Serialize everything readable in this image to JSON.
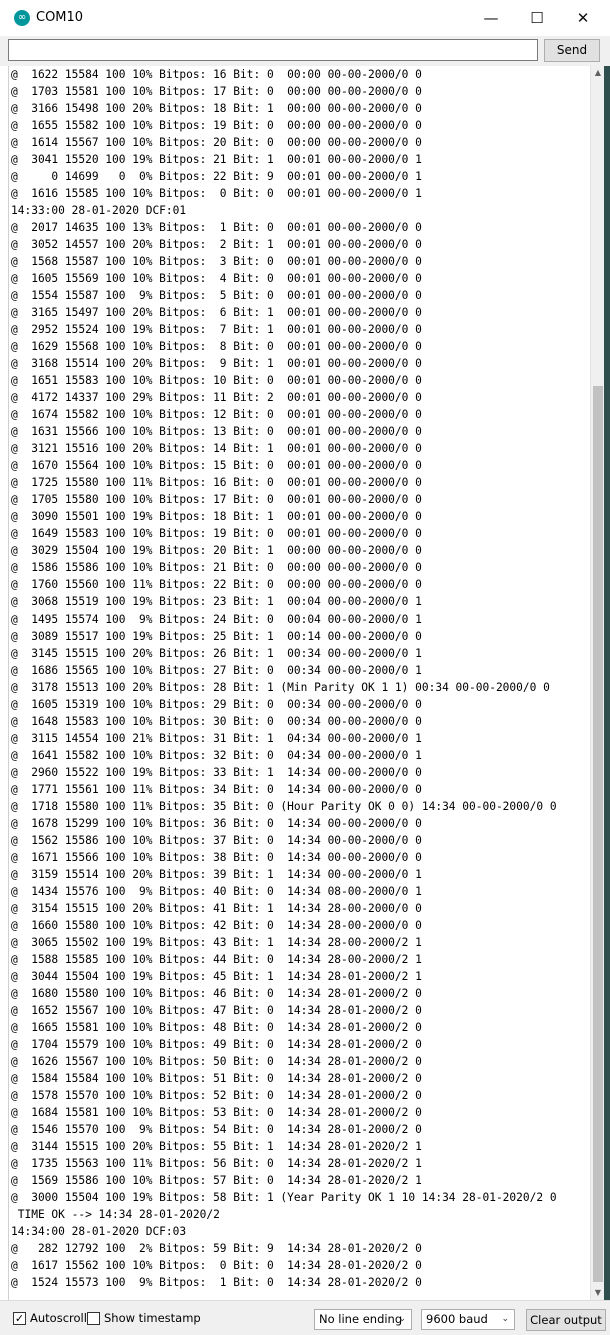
{
  "window": {
    "title": "COM10",
    "minimize_glyph": "—",
    "maximize_glyph": "☐",
    "close_glyph": "✕",
    "app_icon": "arduino-icon"
  },
  "input": {
    "value": "",
    "send_label": "Send"
  },
  "output_lines": [
    "@  1622 15584 100 10% Bitpos: 16 Bit: 0  00:00 00-00-2000/0 0",
    "@  1703 15581 100 10% Bitpos: 17 Bit: 0  00:00 00-00-2000/0 0",
    "@  3166 15498 100 20% Bitpos: 18 Bit: 1  00:00 00-00-2000/0 0",
    "@  1655 15582 100 10% Bitpos: 19 Bit: 0  00:00 00-00-2000/0 0",
    "@  1614 15567 100 10% Bitpos: 20 Bit: 0  00:00 00-00-2000/0 0",
    "@  3041 15520 100 19% Bitpos: 21 Bit: 1  00:01 00-00-2000/0 1",
    "@     0 14699   0  0% Bitpos: 22 Bit: 9  00:01 00-00-2000/0 1",
    "@  1616 15585 100 10% Bitpos:  0 Bit: 0  00:01 00-00-2000/0 1",
    "14:33:00 28-01-2020 DCF:01",
    "@  2017 14635 100 13% Bitpos:  1 Bit: 0  00:01 00-00-2000/0 0",
    "@  3052 14557 100 20% Bitpos:  2 Bit: 1  00:01 00-00-2000/0 0",
    "@  1568 15587 100 10% Bitpos:  3 Bit: 0  00:01 00-00-2000/0 0",
    "@  1605 15569 100 10% Bitpos:  4 Bit: 0  00:01 00-00-2000/0 0",
    "@  1554 15587 100  9% Bitpos:  5 Bit: 0  00:01 00-00-2000/0 0",
    "@  3165 15497 100 20% Bitpos:  6 Bit: 1  00:01 00-00-2000/0 0",
    "@  2952 15524 100 19% Bitpos:  7 Bit: 1  00:01 00-00-2000/0 0",
    "@  1629 15568 100 10% Bitpos:  8 Bit: 0  00:01 00-00-2000/0 0",
    "@  3168 15514 100 20% Bitpos:  9 Bit: 1  00:01 00-00-2000/0 0",
    "@  1651 15583 100 10% Bitpos: 10 Bit: 0  00:01 00-00-2000/0 0",
    "@  4172 14337 100 29% Bitpos: 11 Bit: 2  00:01 00-00-2000/0 0",
    "@  1674 15582 100 10% Bitpos: 12 Bit: 0  00:01 00-00-2000/0 0",
    "@  1631 15566 100 10% Bitpos: 13 Bit: 0  00:01 00-00-2000/0 0",
    "@  3121 15516 100 20% Bitpos: 14 Bit: 1  00:01 00-00-2000/0 0",
    "@  1670 15564 100 10% Bitpos: 15 Bit: 0  00:01 00-00-2000/0 0",
    "@  1725 15580 100 11% Bitpos: 16 Bit: 0  00:01 00-00-2000/0 0",
    "@  1705 15580 100 10% Bitpos: 17 Bit: 0  00:01 00-00-2000/0 0",
    "@  3090 15501 100 19% Bitpos: 18 Bit: 1  00:01 00-00-2000/0 0",
    "@  1649 15583 100 10% Bitpos: 19 Bit: 0  00:01 00-00-2000/0 0",
    "@  3029 15504 100 19% Bitpos: 20 Bit: 1  00:00 00-00-2000/0 0",
    "@  1586 15586 100 10% Bitpos: 21 Bit: 0  00:00 00-00-2000/0 0",
    "@  1760 15560 100 11% Bitpos: 22 Bit: 0  00:00 00-00-2000/0 0",
    "@  3068 15519 100 19% Bitpos: 23 Bit: 1  00:04 00-00-2000/0 1",
    "@  1495 15574 100  9% Bitpos: 24 Bit: 0  00:04 00-00-2000/0 1",
    "@  3089 15517 100 19% Bitpos: 25 Bit: 1  00:14 00-00-2000/0 0",
    "@  3145 15515 100 20% Bitpos: 26 Bit: 1  00:34 00-00-2000/0 1",
    "@  1686 15565 100 10% Bitpos: 27 Bit: 0  00:34 00-00-2000/0 1",
    "@  3178 15513 100 20% Bitpos: 28 Bit: 1 (Min Parity OK 1 1) 00:34 00-00-2000/0 0",
    "@  1605 15319 100 10% Bitpos: 29 Bit: 0  00:34 00-00-2000/0 0",
    "@  1648 15583 100 10% Bitpos: 30 Bit: 0  00:34 00-00-2000/0 0",
    "@  3115 14554 100 21% Bitpos: 31 Bit: 1  04:34 00-00-2000/0 1",
    "@  1641 15582 100 10% Bitpos: 32 Bit: 0  04:34 00-00-2000/0 1",
    "@  2960 15522 100 19% Bitpos: 33 Bit: 1  14:34 00-00-2000/0 0",
    "@  1771 15561 100 11% Bitpos: 34 Bit: 0  14:34 00-00-2000/0 0",
    "@  1718 15580 100 11% Bitpos: 35 Bit: 0 (Hour Parity OK 0 0) 14:34 00-00-2000/0 0",
    "@  1678 15299 100 10% Bitpos: 36 Bit: 0  14:34 00-00-2000/0 0",
    "@  1562 15586 100 10% Bitpos: 37 Bit: 0  14:34 00-00-2000/0 0",
    "@  1671 15566 100 10% Bitpos: 38 Bit: 0  14:34 00-00-2000/0 0",
    "@  3159 15514 100 20% Bitpos: 39 Bit: 1  14:34 00-00-2000/0 1",
    "@  1434 15576 100  9% Bitpos: 40 Bit: 0  14:34 08-00-2000/0 1",
    "@  3154 15515 100 20% Bitpos: 41 Bit: 1  14:34 28-00-2000/0 0",
    "@  1660 15580 100 10% Bitpos: 42 Bit: 0  14:34 28-00-2000/0 0",
    "@  3065 15502 100 19% Bitpos: 43 Bit: 1  14:34 28-00-2000/2 1",
    "@  1588 15585 100 10% Bitpos: 44 Bit: 0  14:34 28-00-2000/2 1",
    "@  3044 15504 100 19% Bitpos: 45 Bit: 1  14:34 28-01-2000/2 1",
    "@  1680 15580 100 10% Bitpos: 46 Bit: 0  14:34 28-01-2000/2 0",
    "@  1652 15567 100 10% Bitpos: 47 Bit: 0  14:34 28-01-2000/2 0",
    "@  1665 15581 100 10% Bitpos: 48 Bit: 0  14:34 28-01-2000/2 0",
    "@  1704 15579 100 10% Bitpos: 49 Bit: 0  14:34 28-01-2000/2 0",
    "@  1626 15567 100 10% Bitpos: 50 Bit: 0  14:34 28-01-2000/2 0",
    "@  1584 15584 100 10% Bitpos: 51 Bit: 0  14:34 28-01-2000/2 0",
    "@  1578 15570 100 10% Bitpos: 52 Bit: 0  14:34 28-01-2000/2 0",
    "@  1684 15581 100 10% Bitpos: 53 Bit: 0  14:34 28-01-2000/2 0",
    "@  1546 15570 100  9% Bitpos: 54 Bit: 0  14:34 28-01-2000/2 0",
    "@  3144 15515 100 20% Bitpos: 55 Bit: 1  14:34 28-01-2020/2 1",
    "@  1735 15563 100 11% Bitpos: 56 Bit: 0  14:34 28-01-2020/2 1",
    "@  1569 15586 100 10% Bitpos: 57 Bit: 0  14:34 28-01-2020/2 1",
    "@  3000 15504 100 19% Bitpos: 58 Bit: 1 (Year Parity OK 1 10 14:34 28-01-2020/2 0",
    " TIME OK --> 14:34 28-01-2020/2",
    "14:34:00 28-01-2020 DCF:03",
    "@   282 12792 100  2% Bitpos: 59 Bit: 9  14:34 28-01-2020/2 0",
    "@  1617 15562 100 10% Bitpos:  0 Bit: 0  14:34 28-01-2020/2 0",
    "@  1524 15573 100  9% Bitpos:  1 Bit: 0  14:34 28-01-2020/2 0"
  ],
  "scrollbar": {
    "up_glyph": "▲",
    "down_glyph": "▼"
  },
  "footer": {
    "autoscroll_label": "Autoscroll",
    "autoscroll_checked": true,
    "check_glyph": "✓",
    "timestamp_label": "Show timestamp",
    "timestamp_checked": false,
    "line_ending": "No line ending",
    "baud": "9600 baud",
    "chevron_glyph": "⌄",
    "clear_label": "Clear output"
  }
}
